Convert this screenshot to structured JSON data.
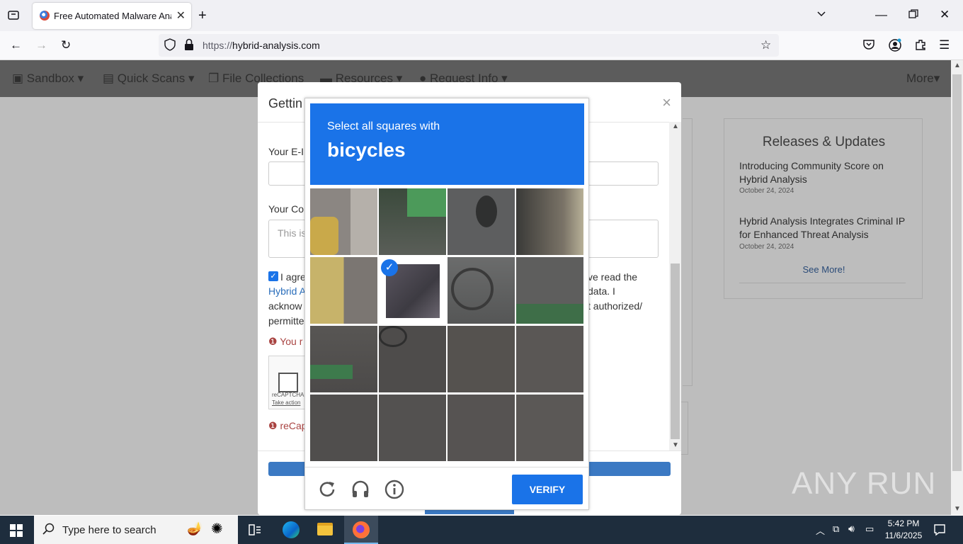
{
  "browser": {
    "tab_title": "Free Automated Malware Analy",
    "url_prefix": "https://",
    "url_domain": "hybrid-analysis.com"
  },
  "site": {
    "nav": [
      "Sandbox",
      "Quick Scans",
      "File Collections",
      "Resources",
      "Request Info",
      "More"
    ],
    "releases": {
      "heading": "Releases & Updates",
      "items": [
        {
          "title": "Introducing Community Score on Hybrid Analysis",
          "date": "October 24, 2024"
        },
        {
          "title": "Hybrid Analysis Integrates Criminal IP for Enhanced Threat Analysis",
          "date": "October 24, 2024"
        }
      ],
      "see_more": "See More!"
    }
  },
  "modal": {
    "title": "Gettin",
    "email_label": "Your E-I",
    "comment_label": "Your Co",
    "comment_placeholder": "This is",
    "agree_left": [
      "I agre",
      "Hybrid A",
      "acknow",
      "permitte"
    ],
    "agree_right": [
      "ve read the",
      "data. I",
      "t authorized/"
    ],
    "error1": "You r",
    "recaptcha_small": "reCAPTCHA",
    "recaptcha_link": "Take action",
    "error2": "reCap"
  },
  "captcha": {
    "instruction": "Select all squares with",
    "keyword": "bicycles",
    "verify_label": "VERIFY",
    "selected_tiles": [
      5
    ],
    "colors": {
      "header": "#1a73e8",
      "verify": "#1a73e8"
    }
  },
  "taskbar": {
    "search_placeholder": "Type here to search",
    "time": "5:42 PM",
    "date": "11/6/2025"
  },
  "watermark": "ANY RUN"
}
